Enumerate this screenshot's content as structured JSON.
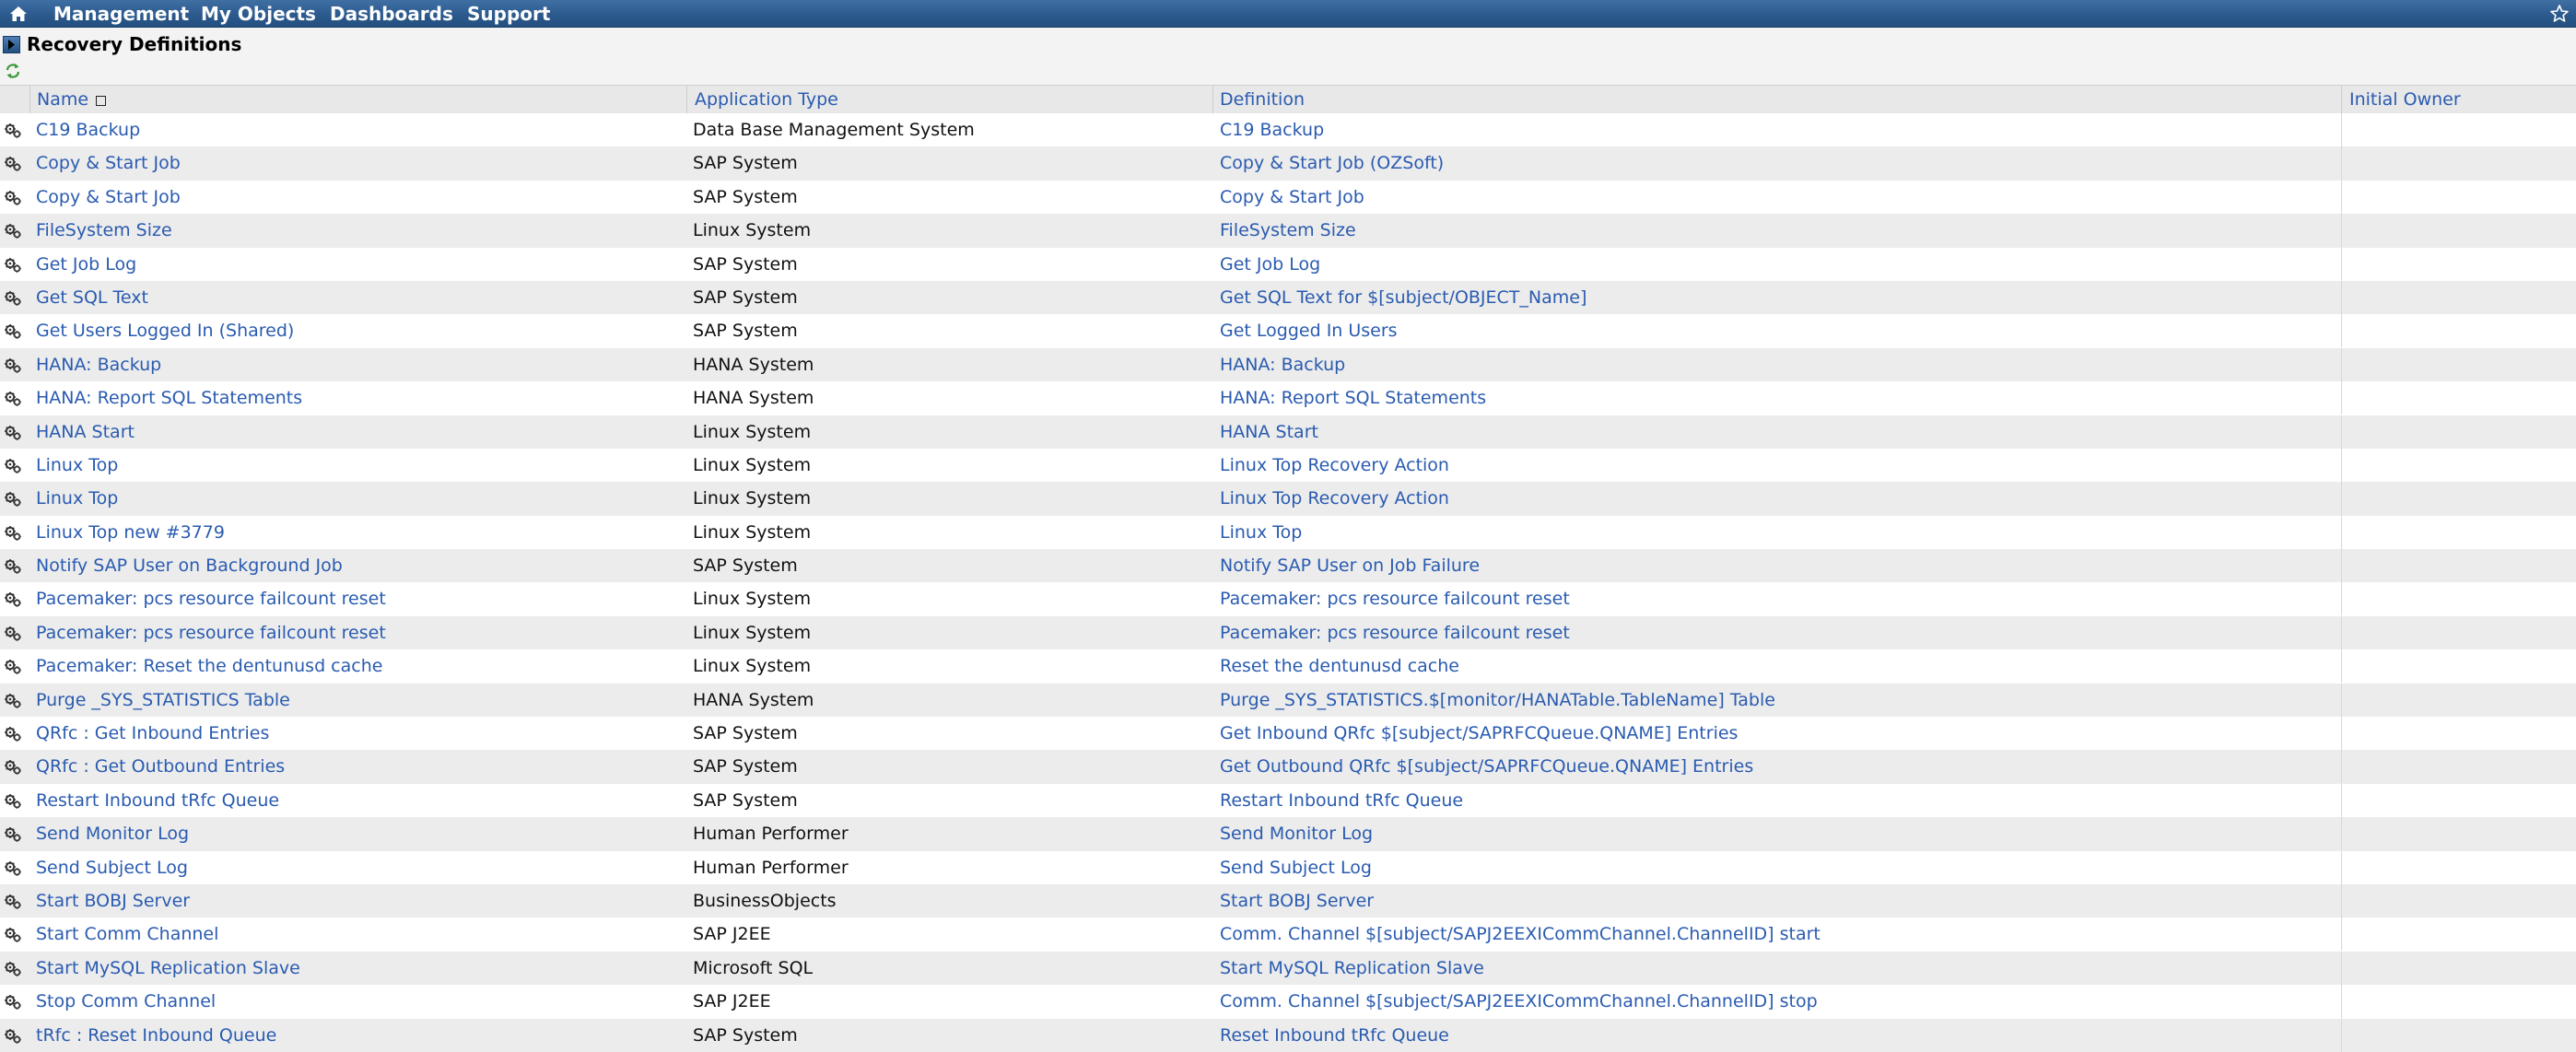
{
  "nav": {
    "items": [
      {
        "label": "Management",
        "name": "nav-management"
      },
      {
        "label": "My Objects",
        "name": "nav-my-objects"
      },
      {
        "label": "Dashboards",
        "name": "nav-dashboards"
      },
      {
        "label": "Support",
        "name": "nav-support"
      }
    ],
    "home_icon": "home-icon",
    "favorite_icon": "star-icon"
  },
  "page": {
    "title": "Recovery Definitions",
    "title_icon": "panel-toggle-icon",
    "refresh_icon": "refresh-icon"
  },
  "table": {
    "columns": {
      "name": "Name",
      "application_type": "Application Type",
      "definition": "Definition",
      "initial_owner": "Initial Owner"
    },
    "row_icon": "gears-icon",
    "rows": [
      {
        "name": "C19 Backup",
        "app_type": "Data Base Management System",
        "definition": "C19 Backup",
        "owner": ""
      },
      {
        "name": "Copy & Start Job",
        "app_type": "SAP System",
        "definition": "Copy & Start Job (OZSoft)",
        "owner": ""
      },
      {
        "name": "Copy & Start Job",
        "app_type": "SAP System",
        "definition": "Copy & Start Job",
        "owner": ""
      },
      {
        "name": "FileSystem Size",
        "app_type": "Linux System",
        "definition": "FileSystem Size",
        "owner": ""
      },
      {
        "name": "Get Job Log",
        "app_type": "SAP System",
        "definition": "Get Job Log",
        "owner": ""
      },
      {
        "name": "Get SQL Text",
        "app_type": "SAP System",
        "definition": "Get SQL Text for $[subject/OBJECT_Name]",
        "owner": ""
      },
      {
        "name": "Get Users Logged In (Shared)",
        "app_type": "SAP System",
        "definition": "Get Logged In Users",
        "owner": ""
      },
      {
        "name": "HANA: Backup",
        "app_type": "HANA System",
        "definition": "HANA: Backup",
        "owner": ""
      },
      {
        "name": "HANA: Report SQL Statements",
        "app_type": "HANA System",
        "definition": "HANA: Report SQL Statements",
        "owner": ""
      },
      {
        "name": "HANA Start",
        "app_type": "Linux System",
        "definition": "HANA Start",
        "owner": ""
      },
      {
        "name": "Linux Top",
        "app_type": "Linux System",
        "definition": "Linux Top Recovery Action",
        "owner": ""
      },
      {
        "name": "Linux Top",
        "app_type": "Linux System",
        "definition": "Linux Top Recovery Action",
        "owner": ""
      },
      {
        "name": "Linux Top new #3779",
        "app_type": "Linux System",
        "definition": "Linux Top",
        "owner": ""
      },
      {
        "name": "Notify SAP User on Background Job",
        "app_type": "SAP System",
        "definition": "Notify SAP User on Job Failure",
        "owner": ""
      },
      {
        "name": "Pacemaker: pcs resource failcount reset",
        "app_type": "Linux System",
        "definition": "Pacemaker: pcs resource failcount reset",
        "owner": ""
      },
      {
        "name": "Pacemaker: pcs resource failcount reset",
        "app_type": "Linux System",
        "definition": "Pacemaker: pcs resource failcount reset",
        "owner": ""
      },
      {
        "name": "Pacemaker: Reset the dentunusd cache",
        "app_type": "Linux System",
        "definition": "Reset the dentunusd cache",
        "owner": ""
      },
      {
        "name": "Purge _SYS_STATISTICS Table",
        "app_type": "HANA System",
        "definition": "Purge _SYS_STATISTICS.$[monitor/HANATable.TableName] Table",
        "owner": ""
      },
      {
        "name": "QRfc : Get Inbound Entries",
        "app_type": "SAP System",
        "definition": "Get Inbound QRfc $[subject/SAPRFCQueue.QNAME] Entries",
        "owner": ""
      },
      {
        "name": "QRfc : Get Outbound Entries",
        "app_type": "SAP System",
        "definition": "Get Outbound QRfc $[subject/SAPRFCQueue.QNAME] Entries",
        "owner": ""
      },
      {
        "name": "Restart Inbound tRfc Queue",
        "app_type": "SAP System",
        "definition": "Restart Inbound tRfc Queue",
        "owner": ""
      },
      {
        "name": "Send Monitor Log",
        "app_type": "Human Performer",
        "definition": "Send Monitor Log",
        "owner": ""
      },
      {
        "name": "Send Subject Log",
        "app_type": "Human Performer",
        "definition": "Send Subject Log",
        "owner": ""
      },
      {
        "name": "Start BOBJ Server",
        "app_type": "BusinessObjects",
        "definition": "Start BOBJ Server",
        "owner": ""
      },
      {
        "name": "Start Comm Channel",
        "app_type": "SAP J2EE",
        "definition": "Comm. Channel $[subject/SAPJ2EEXICommChannel.ChannelID] start",
        "owner": ""
      },
      {
        "name": "Start MySQL Replication Slave",
        "app_type": "Microsoft SQL",
        "definition": "Start MySQL Replication Slave",
        "owner": ""
      },
      {
        "name": "Stop Comm Channel",
        "app_type": "SAP J2EE",
        "definition": "Comm. Channel $[subject/SAPJ2EEXICommChannel.ChannelID] stop",
        "owner": ""
      },
      {
        "name": "tRfc : Reset Inbound Queue",
        "app_type": "SAP System",
        "definition": "Reset Inbound tRfc Queue",
        "owner": ""
      }
    ]
  }
}
